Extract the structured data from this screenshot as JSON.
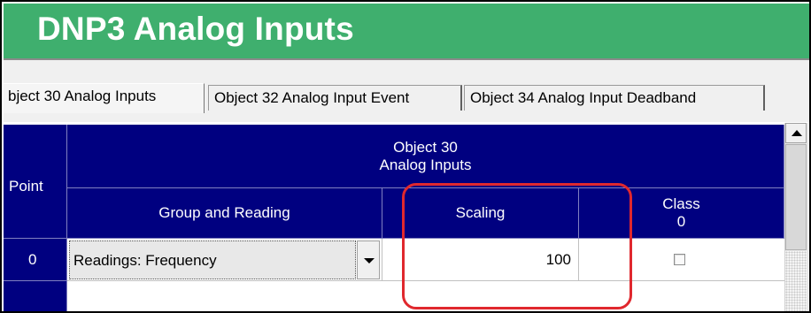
{
  "window": {
    "title": "DNP3 Analog Inputs"
  },
  "tabs": [
    {
      "label": "bject 30 Analog Inputs",
      "active": true
    },
    {
      "label": "Object 32 Analog Input Event",
      "active": false
    },
    {
      "label": "Object 34 Analog Input Deadband",
      "active": false
    }
  ],
  "table": {
    "header": {
      "point": "Point",
      "group_line1": "Object 30",
      "group_line2": "Analog Inputs",
      "group_and_reading": "Group and Reading",
      "scaling": "Scaling",
      "class_line1": "Class",
      "class_line2": "0"
    },
    "rows": [
      {
        "point": "0",
        "group_and_reading": "Readings: Frequency",
        "scaling": "100",
        "class0_checked": false
      }
    ]
  },
  "colors": {
    "title_bar": "#3faf6e",
    "header_bg": "#000080",
    "highlight": "#e0282e"
  },
  "icons": [
    "chevron-down-icon",
    "scroll-up-arrow-icon",
    "checkbox-icon"
  ]
}
